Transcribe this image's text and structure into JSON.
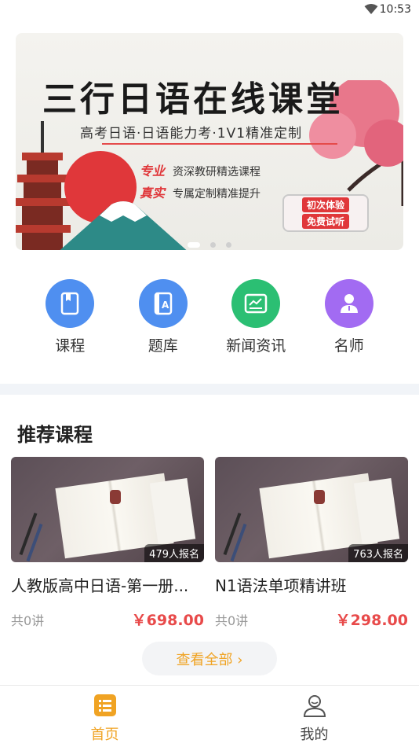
{
  "status_bar": {
    "time": "10:53"
  },
  "banner": {
    "title": "三行日语在线课堂",
    "subtitle": "高考日语·日语能力考·1V1精准定制",
    "features": [
      {
        "highlight": "专业",
        "text": "资深教研精选课程"
      },
      {
        "highlight": "真实",
        "text": "专属定制精准提升"
      }
    ],
    "cta_line1": "初次体验",
    "cta_line2": "免费试听",
    "watermark": "樱花 梅花",
    "page_count": 3,
    "active_index": 0
  },
  "quick_nav": [
    {
      "label": "课程",
      "icon": "bookmark-book-icon",
      "color": "#4f8ff0"
    },
    {
      "label": "题库",
      "icon": "book-letter-a-icon",
      "color": "#4f8ff0"
    },
    {
      "label": "新闻资讯",
      "icon": "news-chart-icon",
      "color": "#2bbf73"
    },
    {
      "label": "名师",
      "icon": "teacher-person-icon",
      "color": "#a26bf2"
    }
  ],
  "section": {
    "title": "推荐课程"
  },
  "courses": [
    {
      "name": "人教版高中日语-第一册...",
      "enrolled": "479人报名",
      "lectures": "共0讲",
      "price": "￥698.00"
    },
    {
      "name": "N1语法单项精讲班",
      "enrolled": "763人报名",
      "lectures": "共0讲",
      "price": "￥298.00"
    }
  ],
  "view_all": {
    "label": "查看全部 ›"
  },
  "tab_bar": {
    "tabs": [
      {
        "label": "首页",
        "icon": "home-list-icon",
        "active": true
      },
      {
        "label": "我的",
        "icon": "user-profile-icon",
        "active": false
      }
    ],
    "active_color": "#f0a323"
  }
}
